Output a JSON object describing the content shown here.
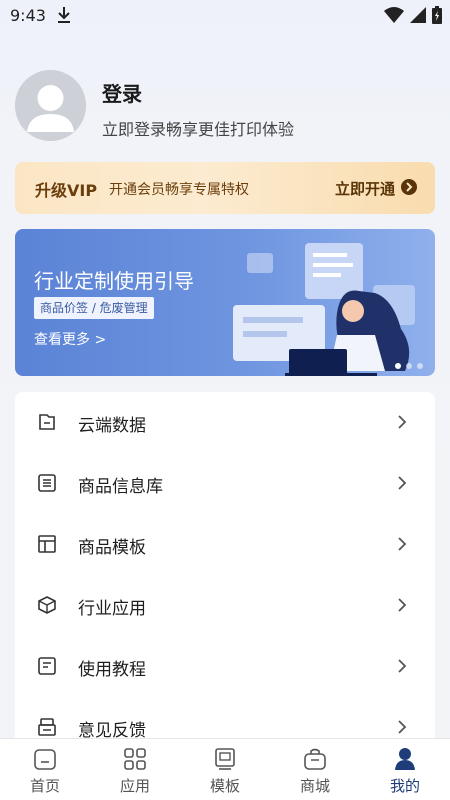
{
  "status_bar": {
    "time": "9:43"
  },
  "profile": {
    "title": "登录",
    "subtitle": "立即登录畅享更佳打印体验"
  },
  "vip": {
    "title": "升级VIP",
    "desc": "开通会员畅享专属特权",
    "action": "立即开通"
  },
  "banner": {
    "title": "行业定制使用引导",
    "tag": "商品价签 / 危废管理",
    "more": "查看更多 >"
  },
  "menu": {
    "items": [
      {
        "label": "云端数据",
        "icon": "cloud-data-icon"
      },
      {
        "label": "商品信息库",
        "icon": "list-icon"
      },
      {
        "label": "商品模板",
        "icon": "template-icon"
      },
      {
        "label": "行业应用",
        "icon": "cube-icon"
      },
      {
        "label": "使用教程",
        "icon": "tutorial-icon"
      },
      {
        "label": "意见反馈",
        "icon": "feedback-icon"
      }
    ]
  },
  "tabbar": {
    "tabs": [
      {
        "label": "首页",
        "icon": "home-icon"
      },
      {
        "label": "应用",
        "icon": "apps-icon"
      },
      {
        "label": "模板",
        "icon": "template-icon"
      },
      {
        "label": "商城",
        "icon": "shop-icon"
      },
      {
        "label": "我的",
        "icon": "profile-icon"
      }
    ],
    "active_index": 4
  },
  "colors": {
    "vip_text": "#6b3f0d",
    "banner": "#5b83d6",
    "active_tab": "#1f3d7a"
  }
}
